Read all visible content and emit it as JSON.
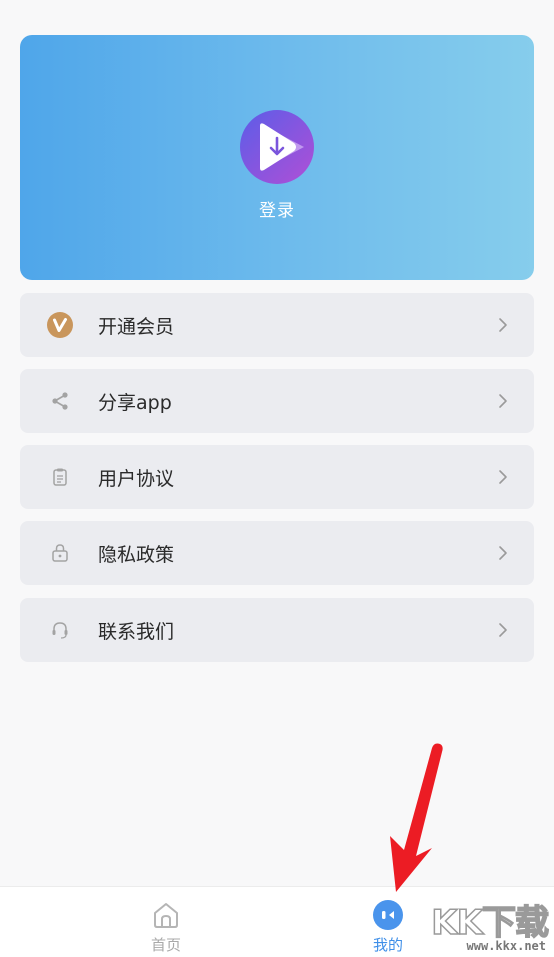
{
  "hero": {
    "login_label": "登录",
    "gradient_start": "#4fa6ea",
    "gradient_end": "#86cdec"
  },
  "menu": {
    "items": [
      {
        "label": "开通会员",
        "icon": "vip-badge-icon"
      },
      {
        "label": "分享app",
        "icon": "share-icon"
      },
      {
        "label": "用户协议",
        "icon": "clipboard-icon"
      },
      {
        "label": "隐私政策",
        "icon": "lock-icon"
      },
      {
        "label": "联系我们",
        "icon": "headset-icon"
      }
    ]
  },
  "tabbar": {
    "home_label": "首页",
    "mine_label": "我的",
    "active_color": "#3f8fe8",
    "inactive_color": "#a9a9a9"
  },
  "watermark": {
    "brand": "KK下载",
    "url": "www.kkx.net"
  }
}
